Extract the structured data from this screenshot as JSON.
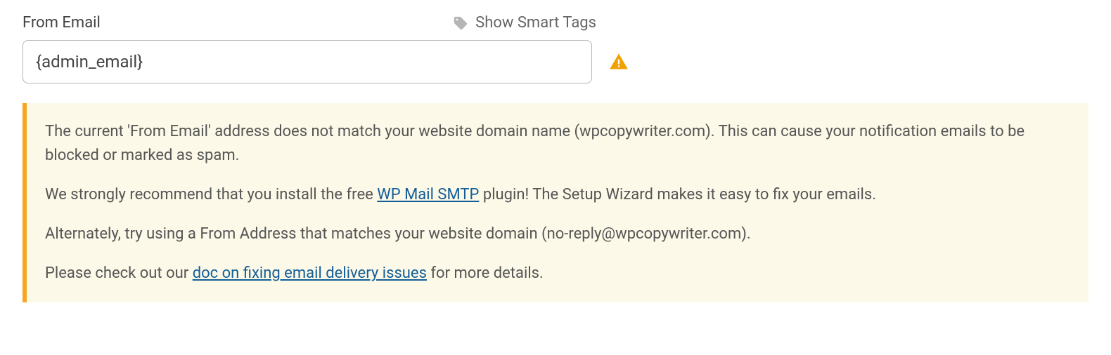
{
  "field": {
    "label": "From Email",
    "value": "{admin_email}"
  },
  "smartTags": {
    "label": "Show Smart Tags"
  },
  "notice": {
    "p1": "The current 'From Email' address does not match your website domain name (wpcopywriter.com). This can cause your notification emails to be blocked or marked as spam.",
    "p2_a": "We strongly recommend that you install the free ",
    "p2_link": "WP Mail SMTP",
    "p2_b": " plugin! The Setup Wizard makes it easy to fix your emails.",
    "p3": "Alternately, try using a From Address that matches your website domain (no-reply@wpcopywriter.com).",
    "p4_a": "Please check out our ",
    "p4_link": "doc on fixing email delivery issues",
    "p4_b": " for more details."
  }
}
